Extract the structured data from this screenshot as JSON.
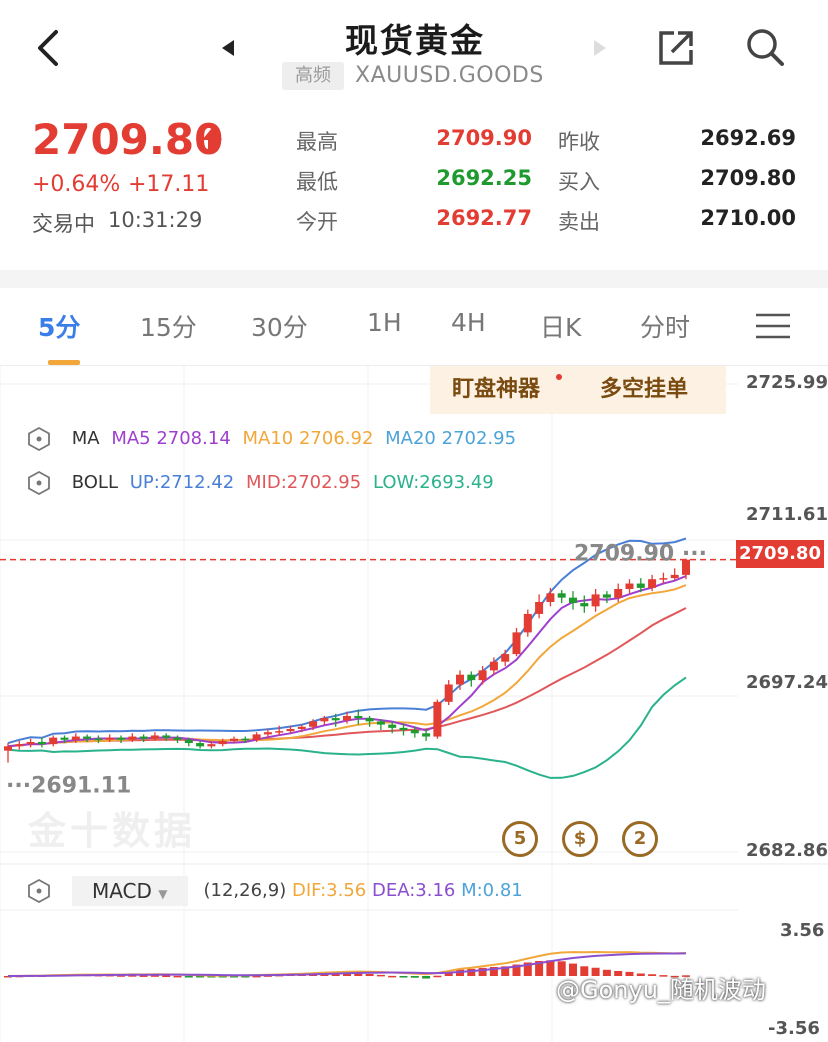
{
  "header": {
    "title": "现货黄金",
    "freq_badge": "高频",
    "symbol": "XAUUSD.GOODS",
    "icons": [
      "back-icon",
      "prev-arrow-icon",
      "next-arrow-icon",
      "share-icon",
      "search-icon"
    ]
  },
  "quote": {
    "last": "2709.80",
    "change_pct": "+0.64%",
    "change_abs": "+17.11",
    "status": "交易中",
    "time": "10:31:29",
    "high_label": "最高",
    "high": "2709.90",
    "low_label": "最低",
    "low": "2692.25",
    "open_label": "今开",
    "open": "2692.77",
    "prev_close_label": "昨收",
    "prev_close": "2692.69",
    "bid_label": "买入",
    "bid": "2709.80",
    "ask_label": "卖出",
    "ask": "2710.00"
  },
  "tabs": [
    "5分",
    "15分",
    "30分",
    "1H",
    "4H",
    "日K",
    "分时"
  ],
  "active_tab": 0,
  "tools": {
    "monitor": "盯盘神器",
    "long_short": "多空挂单"
  },
  "legend": {
    "ma_label": "MA",
    "ma5": "MA5 2708.14",
    "ma10": "MA10 2706.92",
    "ma20": "MA20 2702.95",
    "boll_label": "BOLL",
    "up": "UP:2712.42",
    "mid": "MID:2702.95",
    "low": "LOW:2693.49"
  },
  "macd": {
    "select": "MACD",
    "params": "(12,26,9)",
    "dif": "DIF:3.56",
    "dea": "DEA:3.16",
    "m": "M:0.81"
  },
  "watermark": "金十数据",
  "credit": "@Gonyu_随机波动",
  "colors": {
    "up": "#e23c33",
    "down": "#1f9a2e",
    "ma5": "#a03fcf",
    "ma10": "#f2a73a",
    "ma20": "#4da3d8",
    "boll_up": "#4a7fd6",
    "boll_mid": "#e0575a",
    "boll_low": "#2ab28c",
    "dif": "#f2a73a",
    "dea": "#8a4fcf"
  },
  "chart_data": {
    "type": "candlestick",
    "ylim": [
      2682.86,
      2725.99
    ],
    "y_ticks": [
      "2725.99",
      "2711.61",
      "2697.24",
      "2682.86"
    ],
    "current_price": "2709.80",
    "high_marker": "2709.90",
    "low_marker": "2691.11",
    "events": [
      "5",
      "$",
      "2"
    ],
    "candles": [
      [
        2692.2,
        2692.6,
        2691.1,
        2692.9
      ],
      [
        2692.6,
        2692.8,
        2692.3,
        2693.1
      ],
      [
        2692.8,
        2693.0,
        2692.5,
        2693.3
      ],
      [
        2693.0,
        2692.8,
        2692.5,
        2693.4
      ],
      [
        2692.8,
        2693.4,
        2692.6,
        2693.6
      ],
      [
        2693.4,
        2693.2,
        2692.9,
        2693.6
      ],
      [
        2693.2,
        2693.5,
        2692.9,
        2693.8
      ],
      [
        2693.5,
        2693.3,
        2693.0,
        2693.7
      ],
      [
        2693.3,
        2693.2,
        2692.9,
        2693.6
      ],
      [
        2693.2,
        2693.4,
        2693.0,
        2693.7
      ],
      [
        2693.4,
        2693.2,
        2692.9,
        2693.6
      ],
      [
        2693.2,
        2693.5,
        2693.0,
        2693.8
      ],
      [
        2693.5,
        2693.3,
        2693.0,
        2693.7
      ],
      [
        2693.3,
        2693.6,
        2693.1,
        2693.9
      ],
      [
        2693.6,
        2693.4,
        2693.1,
        2693.8
      ],
      [
        2693.4,
        2693.2,
        2692.9,
        2693.6
      ],
      [
        2693.2,
        2692.9,
        2692.6,
        2693.4
      ],
      [
        2692.9,
        2692.6,
        2692.4,
        2693.1
      ],
      [
        2692.6,
        2692.8,
        2692.4,
        2693.1
      ],
      [
        2692.8,
        2693.1,
        2692.6,
        2693.3
      ],
      [
        2693.1,
        2693.3,
        2692.9,
        2693.5
      ],
      [
        2693.3,
        2693.2,
        2692.9,
        2693.5
      ],
      [
        2693.2,
        2693.7,
        2693.0,
        2693.9
      ],
      [
        2693.7,
        2693.9,
        2693.4,
        2694.2
      ],
      [
        2693.9,
        2694.0,
        2693.6,
        2694.5
      ],
      [
        2694.0,
        2694.2,
        2693.8,
        2694.5
      ],
      [
        2694.2,
        2694.4,
        2693.9,
        2694.6
      ],
      [
        2694.4,
        2694.9,
        2694.1,
        2695.1
      ],
      [
        2694.9,
        2695.2,
        2694.6,
        2695.4
      ],
      [
        2695.2,
        2695.0,
        2694.4,
        2695.6
      ],
      [
        2695.0,
        2695.4,
        2694.7,
        2695.8
      ],
      [
        2695.4,
        2695.2,
        2694.6,
        2696.0
      ],
      [
        2695.2,
        2694.9,
        2694.4,
        2695.4
      ],
      [
        2694.9,
        2694.6,
        2694.1,
        2695.1
      ],
      [
        2694.6,
        2694.3,
        2693.8,
        2694.9
      ],
      [
        2694.3,
        2694.1,
        2693.6,
        2694.7
      ],
      [
        2694.1,
        2693.8,
        2693.4,
        2694.4
      ],
      [
        2693.8,
        2693.5,
        2693.1,
        2694.2
      ],
      [
        2693.5,
        2696.7,
        2693.3,
        2696.9
      ],
      [
        2696.7,
        2698.3,
        2696.4,
        2698.7
      ],
      [
        2698.3,
        2699.2,
        2697.8,
        2699.6
      ],
      [
        2699.2,
        2698.7,
        2698.1,
        2699.5
      ],
      [
        2698.7,
        2699.6,
        2698.3,
        2700.0
      ],
      [
        2699.6,
        2700.4,
        2699.2,
        2700.8
      ],
      [
        2700.4,
        2701.1,
        2700.0,
        2701.5
      ],
      [
        2701.1,
        2703.1,
        2700.9,
        2703.5
      ],
      [
        2703.1,
        2704.8,
        2702.7,
        2705.2
      ],
      [
        2704.8,
        2705.9,
        2704.4,
        2706.6
      ],
      [
        2705.9,
        2706.7,
        2705.5,
        2707.2
      ],
      [
        2706.7,
        2706.3,
        2705.8,
        2707.0
      ],
      [
        2706.3,
        2705.8,
        2705.2,
        2706.9
      ],
      [
        2705.8,
        2705.5,
        2704.9,
        2706.5
      ],
      [
        2705.5,
        2706.6,
        2705.0,
        2707.1
      ],
      [
        2706.6,
        2706.3,
        2705.8,
        2706.9
      ],
      [
        2706.3,
        2707.1,
        2705.9,
        2707.6
      ],
      [
        2707.1,
        2707.6,
        2706.7,
        2708.0
      ],
      [
        2707.6,
        2707.2,
        2706.8,
        2708.1
      ],
      [
        2707.2,
        2708.0,
        2706.9,
        2708.4
      ],
      [
        2708.0,
        2708.1,
        2707.6,
        2708.6
      ],
      [
        2708.1,
        2708.4,
        2707.9,
        2709.0
      ],
      [
        2708.4,
        2709.8,
        2708.0,
        2709.9
      ]
    ]
  },
  "macd_data": {
    "ylim": [
      -3.56,
      3.56
    ],
    "y_ticks": [
      "3.56",
      "-3.56"
    ]
  }
}
